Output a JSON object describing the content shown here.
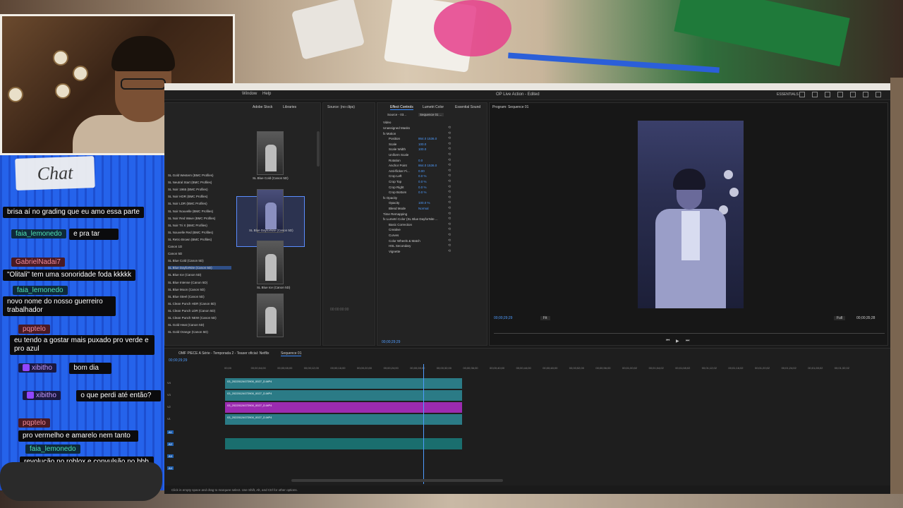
{
  "chat": {
    "title": "Chat",
    "messages": [
      {
        "user": "",
        "text": "brisa aí no grading que eu amo essa parte",
        "color": "teal"
      },
      {
        "user": "faia_lemonedo",
        "text": "e pra tar",
        "color": "teal"
      },
      {
        "user": "GabrielNadai7",
        "text": "\"Olitali\" tem uma sonoridade foda kkkkk",
        "color": "pink"
      },
      {
        "user": "faia_lemonedo",
        "text": "novo nome do nosso guerreiro trabalhador",
        "color": "teal"
      },
      {
        "user": "pqptelo",
        "text": "eu tendo a gostar mais puxado pro verde e pro azul",
        "color": "pink"
      },
      {
        "user": "xibitho",
        "text": "bom dia",
        "color": "purple"
      },
      {
        "user": "xibitho",
        "text": "o que perdi até então?",
        "color": "purple"
      },
      {
        "user": "pqptelo",
        "text": "pro vermelho e amarelo nem tanto",
        "color": "pink"
      },
      {
        "user": "faia_lemonedo",
        "text": "revolução no roblox e convulsão no bbb",
        "color": "teal"
      }
    ]
  },
  "app": {
    "menu": [
      "Window",
      "Help"
    ],
    "title": "OP Live Action - Edited",
    "workspace": "ESSENTIALS",
    "library": {
      "tabs": [
        "Adobe Stock",
        "Libraries"
      ],
      "items": [
        "SL Gold Western (BMC Profiles)",
        "SL Neutral Start (BMC Profiles)",
        "SL Noir 1965 (BMC Profiles)",
        "SL Noir HDR (BMC Profiles)",
        "SL Noir LDR (BMC Profiles)",
        "SL Noir Nouvelle (BMC Profiles)",
        "SL Noir Red Wave (BMC Profiles)",
        "SL Noir Tri X (BMC Profiles)",
        "SL Nouvelle Red (BMC Profiles)",
        "SL Retro Brown (BMC Profiles)",
        "Canon 1D",
        "Canon 5D",
        "SL Blue Cold (Canon 5D)",
        "SL Blue DayforNite (Canon 5D)",
        "SL Blue Ice (Canon 5D)",
        "SL Blue Intense (Canon 5D)",
        "SL Blue Moon (Canon 5D)",
        "SL Blue Steel (Canon 5D)",
        "SL Clean Punch HDR (Canon 5D)",
        "SL Clean Punch LDR (Canon 5D)",
        "SL Clean Punch NEW (Canon 5D)",
        "SL Gold Heat (Canon 5D)",
        "SL Gold Orange (Canon 5D)"
      ],
      "selected_index": 13,
      "thumbs": [
        "SL Blue Cold (Canon 5D)",
        "SL Blue DayforNite (Canon 5D)",
        "SL Blue Ice (Canon 5D)"
      ]
    },
    "source": {
      "tab": "Source: (no clips)",
      "timecode": "00:00:00:00"
    },
    "effects": {
      "tabs": [
        "Effect Controls",
        "Lumetri Color",
        "Essential Sound"
      ],
      "source_label": "Source - 03...",
      "seq_label": "Sequence 01 ...",
      "section_video": "Video",
      "rows": [
        {
          "label": "Unassigned Masks",
          "value": ""
        },
        {
          "label": "fx Motion",
          "value": ""
        },
        {
          "label": "Position",
          "value": "864.0   1536.0"
        },
        {
          "label": "Scale",
          "value": "100.0"
        },
        {
          "label": "Scale Width",
          "value": "100.0"
        },
        {
          "label": "Uniform Scale",
          "value": ""
        },
        {
          "label": "Rotation",
          "value": "0.0"
        },
        {
          "label": "Anchor Point",
          "value": "864.0   1536.0"
        },
        {
          "label": "Anti-flicker Fi...",
          "value": "0.00"
        },
        {
          "label": "Crop Left",
          "value": "0.0 %"
        },
        {
          "label": "Crop Top",
          "value": "0.0 %"
        },
        {
          "label": "Crop Right",
          "value": "0.0 %"
        },
        {
          "label": "Crop Bottom",
          "value": "0.0 %"
        },
        {
          "label": "fx Opacity",
          "value": ""
        },
        {
          "label": "Opacity",
          "value": "100.0 %"
        },
        {
          "label": "Blend Mode",
          "value": "Normal"
        },
        {
          "label": "Time Remapping",
          "value": ""
        },
        {
          "label": "fx Lumetri Color (SL Blue DayforNite ...",
          "value": ""
        },
        {
          "label": "Basic Correction",
          "value": ""
        },
        {
          "label": "Creative",
          "value": ""
        },
        {
          "label": "Curves",
          "value": ""
        },
        {
          "label": "Color Wheels & Match",
          "value": ""
        },
        {
          "label": "HSL Secondary",
          "value": ""
        },
        {
          "label": "Vignette",
          "value": ""
        }
      ],
      "timecode": "00;00;29;29"
    },
    "program": {
      "tab": "Program: Sequence 01",
      "timecode": "00;00;29;29",
      "fit": "Fit",
      "quality": "Full",
      "duration": "00;00;35;28"
    },
    "timeline": {
      "tabs": [
        "OMF PIECE A Série - Temporada 2 - Teaser oficial: Netflix",
        "Sequence 01"
      ],
      "timecode": "00;00;29;29",
      "ruler": [
        "00;00",
        "00;00;04;00",
        "00;00;08;00",
        "00;00;12;00",
        "00;00;16;00",
        "00;00;20;00",
        "00;00;24;00",
        "00;00;28;00",
        "00;00;32;00",
        "00;00;36;00",
        "00;00;40;00",
        "00;00;44;00",
        "00;00;48;00",
        "00;00;52;00",
        "00;00;56;00",
        "00;01;00;02",
        "00;01;04;02",
        "00;01;08;02",
        "00;01;12;02",
        "00;01;16;02",
        "00;01;20;02",
        "00;01;24;02",
        "00;01;28;02",
        "00;01;32;02"
      ],
      "tracks": [
        "V4",
        "V3",
        "V2",
        "V1",
        "A1",
        "A2",
        "A3",
        "A4"
      ],
      "clips": [
        {
          "track": "V4",
          "name": "03_20220124072900_0027_D.MP4",
          "color": "#2b7b86"
        },
        {
          "track": "V3",
          "name": "03_20220124072900_0027_D.MP4",
          "color": "#2b7b86"
        },
        {
          "track": "V2",
          "name": "03_20220124072900_0027_D.MP4",
          "color": "#9b2bb0"
        },
        {
          "track": "V1",
          "name": "03_20220124072900_0027_D.MP4",
          "color": "#2b7b86"
        }
      ]
    },
    "status_text": "Click in empty space and drag to marquee select. Use Shift, Alt, and Ctrl for other options."
  }
}
